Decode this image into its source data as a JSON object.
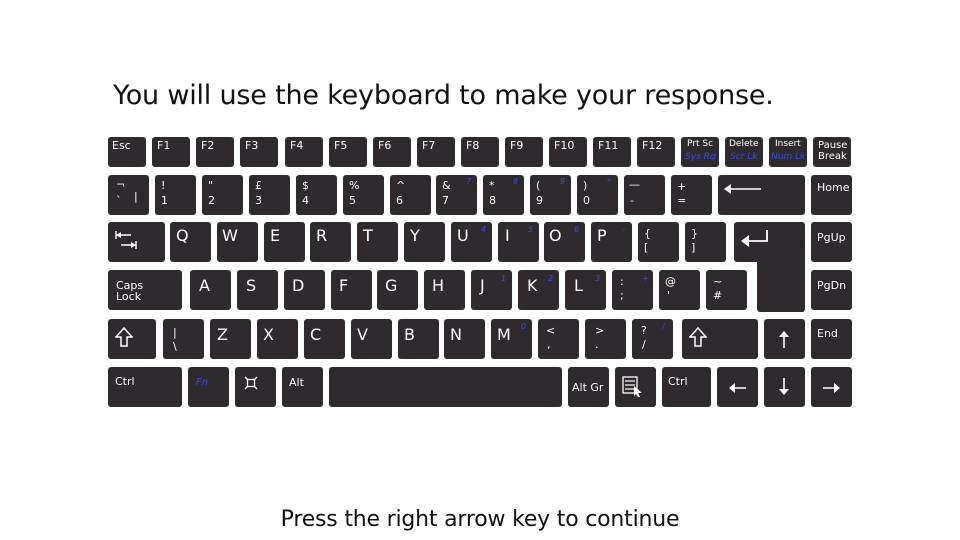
{
  "instruction": "You will use the keyboard to make your response.",
  "footer": "Press the right arrow key to continue",
  "keys": {
    "esc": "Esc",
    "f1": "F1",
    "f2": "F2",
    "f3": "F3",
    "f4": "F4",
    "f5": "F5",
    "f6": "F6",
    "f7": "F7",
    "f8": "F8",
    "f9": "F9",
    "f10": "F10",
    "f11": "F11",
    "f12": "F12",
    "prtsc": "Prt Sc",
    "sysrq": "Sys Rq",
    "delete": "Delete",
    "scrlk": "Scr Lk",
    "insert": "Insert",
    "numlk": "Num Lk",
    "pause": "Pause",
    "break": "Break",
    "grave_top": "¬",
    "grave_bl": "`",
    "grave_br": "|",
    "n1_top": "!",
    "n1": "1",
    "n2_top": "\"",
    "n2": "2",
    "n3_top": "£",
    "n3": "3",
    "n4_top": "$",
    "n4": "4",
    "n5_top": "%",
    "n5": "5",
    "n6_top": "^",
    "n6": "6",
    "n7_top": "&",
    "n7": "7",
    "n7_num": "7",
    "n8_top": "*",
    "n8": "8",
    "n8_num": "8",
    "n9_top": "(",
    "n9": "9",
    "n9_num": "9",
    "n0_top": ")",
    "n0": "0",
    "n0_num": "*",
    "minus_top": "—",
    "minus": "-",
    "equals_top": "+",
    "equals": "=",
    "home": "Home",
    "pgup": "PgUp",
    "pgdn": "PgDn",
    "end": "End",
    "q": "Q",
    "w": "W",
    "e": "E",
    "r": "R",
    "t": "T",
    "y": "Y",
    "u": "U",
    "u_num": "4",
    "i": "I",
    "i_num": "5",
    "o": "O",
    "o_num": "6",
    "p": "P",
    "p_num": "-",
    "lbrace_top": "{",
    "lbrace": "[",
    "rbrace_top": "}",
    "rbrace": "]",
    "caps_line1": "Caps",
    "caps_line2": "Lock",
    "a": "A",
    "s": "S",
    "d": "D",
    "f": "F",
    "g": "G",
    "h": "H",
    "j": "J",
    "j_num": "1",
    "k": "K",
    "k_num": "2",
    "l": "L",
    "l_num": "3",
    "semi_top": ":",
    "semi": ";",
    "semi_num": "+",
    "quote_top": "@",
    "quote": "'",
    "hash_top": "~",
    "hash": "#",
    "bslash_top": "|",
    "bslash": "\\",
    "z": "Z",
    "x": "X",
    "c": "C",
    "v": "V",
    "b": "B",
    "n": "N",
    "m": "M",
    "m_num": "0",
    "comma_top": "<",
    "comma": ",",
    "period_top": ">",
    "period": ".",
    "slash_top": "?",
    "slash": "/",
    "slash_num": "/",
    "ctrl": "Ctrl",
    "fn": "Fn",
    "alt": "Alt",
    "altgr": "Alt Gr",
    "ctrl_right": "Ctrl"
  },
  "icons": {
    "tab": "tab-arrows-icon",
    "backspace": "left-long-arrow-icon",
    "enter": "return-arrow-icon",
    "shift": "shift-outline-arrow-icon",
    "super": "command-loop-icon",
    "menu": "context-menu-icon",
    "arrows": [
      "left-arrow-icon",
      "down-arrow-icon",
      "up-arrow-icon",
      "right-arrow-icon"
    ]
  }
}
